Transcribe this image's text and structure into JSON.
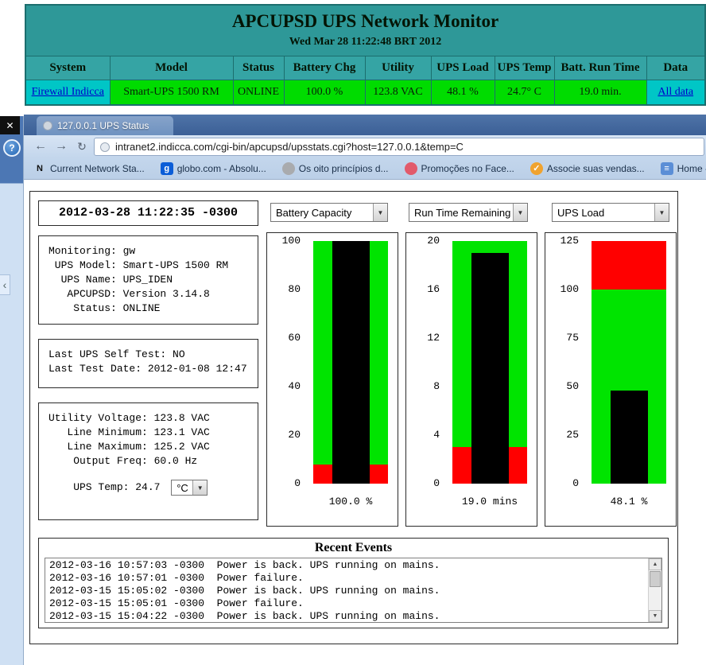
{
  "monitor_window": {
    "title": "APCUPSD UPS Network Monitor",
    "subtitle": "Wed Mar 28 11:22:48 BRT 2012",
    "columns": [
      "System",
      "Model",
      "Status",
      "Battery Chg",
      "Utility",
      "UPS Load",
      "UPS Temp",
      "Batt. Run Time",
      "Data"
    ],
    "row": {
      "system": "Firewall Indicca",
      "model": "Smart-UPS 1500 RM",
      "status": "ONLINE",
      "battery": "100.0 %",
      "utility": "123.8 VAC",
      "load": "48.1 %",
      "temp": "24.7° C",
      "runtime": "19.0 min.",
      "data": "All data"
    },
    "colors": {
      "header_bg": "#2f9c9c",
      "link_cell_bg": "#00c6c6",
      "ok_cell_bg": "#00dc00",
      "link_color": "#0000cc"
    }
  },
  "desktop": {
    "close_glyph": "✕",
    "help_glyph": "?",
    "collapse_glyph": "‹"
  },
  "browser": {
    "tab_title": "127.0.0.1 UPS Status",
    "url": "intranet2.indicca.com/cgi-bin/apcupsd/upsstats.cgi?host=127.0.0.1&temp=C",
    "back_glyph": "←",
    "forward_glyph": "→",
    "reload_glyph": "↻",
    "bookmarks": [
      {
        "label": "Current Network Sta...",
        "glyph": "N",
        "bg": "transparent",
        "fg": "#111111",
        "shape": "square"
      },
      {
        "label": "globo.com - Absolu...",
        "glyph": "g",
        "bg": "#0b5dd7",
        "fg": "#ffffff",
        "shape": "square"
      },
      {
        "label": "Os oito princípios d...",
        "glyph": "",
        "bg": "#a9abae",
        "fg": "#ffffff",
        "shape": "circle"
      },
      {
        "label": "Promoções no Face...",
        "glyph": "",
        "bg": "#e25a6b",
        "fg": "#ffffff",
        "shape": "circle"
      },
      {
        "label": "Associe suas vendas...",
        "glyph": "✓",
        "bg": "#f0a32f",
        "fg": "#ffffff",
        "shape": "circle"
      },
      {
        "label": "Home - Googl",
        "glyph": "≡",
        "bg": "#5b8ed6",
        "fg": "#ffffff",
        "shape": "square"
      }
    ]
  },
  "page": {
    "timestamp": "2012-03-28 11:22:35 -0300",
    "dropdowns": [
      "Battery Capacity",
      "Run Time Remaining",
      "UPS Load"
    ],
    "monitor_info": [
      "Monitoring: gw",
      " UPS Model: Smart-UPS 1500 RM",
      "  UPS Name: UPS_IDEN",
      "   APCUPSD: Version 3.14.8",
      "    Status: ONLINE"
    ],
    "selftest_info": [
      "Last UPS Self Test: NO",
      "Last Test Date: 2012-01-08 12:47"
    ],
    "utility_info": [
      "Utility Voltage: 123.8 VAC",
      "   Line Minimum: 123.1 VAC",
      "   Line Maximum: 125.2 VAC",
      "    Output Freq: 60.0 Hz"
    ],
    "temp_line": "    UPS Temp: 24.7 ",
    "temp_unit": "°C",
    "events_title": "Recent Events",
    "events": [
      "2012-03-16 10:57:03 -0300  Power is back. UPS running on mains.",
      "2012-03-16 10:57:01 -0300  Power failure.",
      "2012-03-15 15:05:02 -0300  Power is back. UPS running on mains.",
      "2012-03-15 15:05:01 -0300  Power failure.",
      "2012-03-15 15:04:22 -0300  Power is back. UPS running on mains."
    ]
  },
  "chart_data": [
    {
      "type": "bar",
      "title": "Battery Capacity",
      "ylabel": "%",
      "ylim": [
        0,
        100
      ],
      "ticks": [
        0,
        20,
        40,
        60,
        80,
        100
      ],
      "value": 100.0,
      "label": "100.0 %",
      "zones": [
        {
          "from": 0,
          "to": 8,
          "color": "#ff0000"
        },
        {
          "from": 8,
          "to": 100,
          "color": "#00e400"
        }
      ]
    },
    {
      "type": "bar",
      "title": "Run Time Remaining",
      "ylabel": "minutes",
      "ylim": [
        0,
        20
      ],
      "ticks": [
        0,
        4,
        8,
        12,
        16,
        20
      ],
      "value": 19.0,
      "label": "19.0 mins",
      "zones": [
        {
          "from": 0,
          "to": 3,
          "color": "#ff0000"
        },
        {
          "from": 3,
          "to": 20,
          "color": "#00e400"
        }
      ]
    },
    {
      "type": "bar",
      "title": "UPS Load",
      "ylabel": "%",
      "ylim": [
        0,
        125
      ],
      "ticks": [
        0,
        25,
        50,
        75,
        100,
        125
      ],
      "value": 48.1,
      "label": "48.1 %",
      "zones": [
        {
          "from": 0,
          "to": 100,
          "color": "#00e400"
        },
        {
          "from": 100,
          "to": 125,
          "color": "#ff0000"
        }
      ]
    }
  ]
}
